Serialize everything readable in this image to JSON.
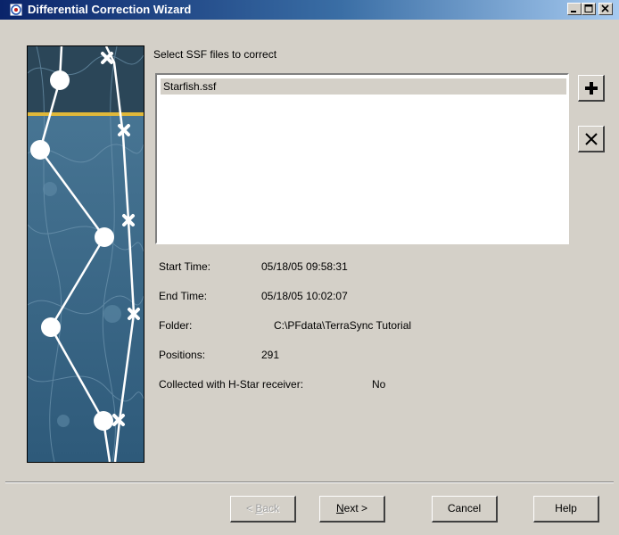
{
  "window": {
    "title": "Differential Correction Wizard"
  },
  "main": {
    "prompt": "Select SSF files to correct",
    "files": [
      "Starfish.ssf"
    ],
    "details": {
      "start_time_label": "Start Time:",
      "start_time_value": "05/18/05 09:58:31",
      "end_time_label": "End Time:",
      "end_time_value": "05/18/05 10:02:07",
      "folder_label": "Folder:",
      "folder_value": "C:\\PFdata\\TerraSync Tutorial",
      "positions_label": "Positions:",
      "positions_value": "291",
      "hstar_label": "Collected with H-Star receiver:",
      "hstar_value": "No"
    }
  },
  "footer": {
    "back_prefix": "< ",
    "back_ul": "B",
    "back_rest": "ack",
    "next_ul": "N",
    "next_rest": "ext >",
    "cancel": "Cancel",
    "help": "Help"
  },
  "colors": {
    "titlebar_start": "#0a246a",
    "titlebar_end": "#a6caf0",
    "dialog_bg": "#d4d0c8",
    "art_blue": "#3f6d8c",
    "art_accent_line": "#e0b83a"
  }
}
